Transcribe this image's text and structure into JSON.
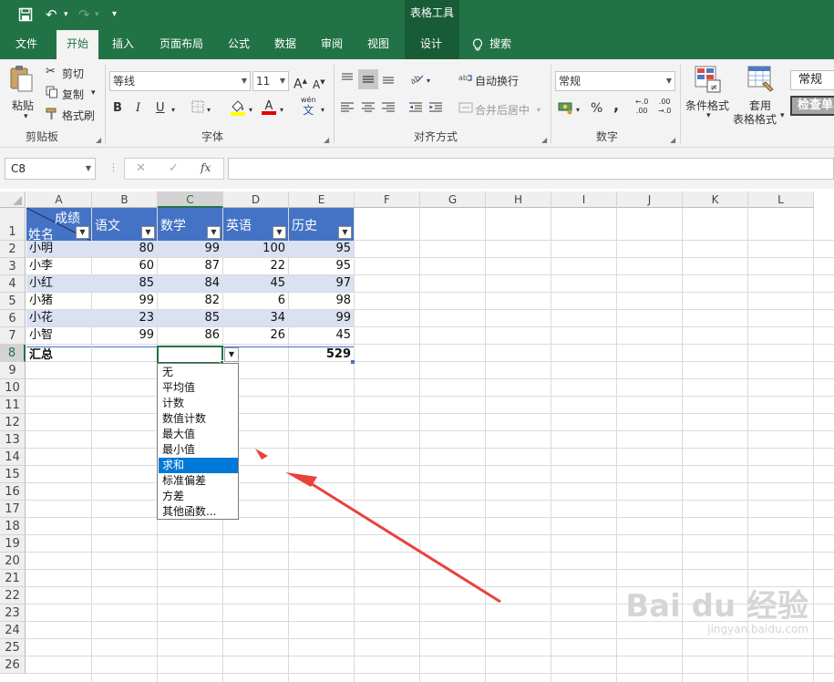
{
  "titlebar": {
    "undo": "↶",
    "redo": "↷",
    "customize": "▾",
    "context_title": "表格工具"
  },
  "tabs": [
    {
      "label": "文件"
    },
    {
      "label": "开始"
    },
    {
      "label": "插入"
    },
    {
      "label": "页面布局"
    },
    {
      "label": "公式"
    },
    {
      "label": "数据"
    },
    {
      "label": "审阅"
    },
    {
      "label": "视图"
    },
    {
      "label": "设计"
    },
    {
      "label": "搜索"
    }
  ],
  "ribbon": {
    "clipboard": {
      "paste": "粘贴",
      "cut": "剪切",
      "copy": "复制",
      "format_painter": "格式刷",
      "group": "剪贴板"
    },
    "font": {
      "name": "等线",
      "size": "11",
      "grow": "A",
      "shrink": "A",
      "bold": "B",
      "italic": "I",
      "underline": "U",
      "phonetic_top": "wén",
      "phonetic_bottom": "文",
      "group": "字体",
      "fill_color": "#ffff00",
      "font_color": "#e00000"
    },
    "alignment": {
      "wrap": "自动换行",
      "merge": "合并后居中",
      "group": "对齐方式"
    },
    "number": {
      "format": "常规",
      "percent": "%",
      "comma": ",",
      "inc_decimal_top": "←.0",
      "inc_decimal_bottom": ".00",
      "dec_decimal_top": ".00",
      "dec_decimal_bottom": "→.0",
      "group": "数字"
    },
    "styles": {
      "conditional": "条件格式",
      "table_format_1": "套用",
      "table_format_2": "表格格式",
      "normal": "常规",
      "check_cell": "检查单"
    }
  },
  "formula_bar": {
    "name_box": "C8",
    "cancel": "✕",
    "enter": "✓",
    "fx": "fx",
    "value": ""
  },
  "columns": [
    "A",
    "B",
    "C",
    "D",
    "E",
    "F",
    "G",
    "H",
    "I",
    "J",
    "K",
    "L"
  ],
  "rows": [
    "1",
    "2",
    "3",
    "4",
    "5",
    "6",
    "7",
    "8",
    "9",
    "10",
    "11",
    "12",
    "13",
    "14",
    "15",
    "16",
    "17",
    "18",
    "19",
    "20",
    "21",
    "22",
    "23",
    "24",
    "25",
    "26"
  ],
  "table": {
    "corner_top": "成绩",
    "corner_bottom": "姓名",
    "headers": [
      "语文",
      "数学",
      "英语",
      "历史"
    ],
    "rows": [
      {
        "name": "小明",
        "values": [
          "80",
          "99",
          "100",
          "95"
        ]
      },
      {
        "name": "小李",
        "values": [
          "60",
          "87",
          "22",
          "95"
        ]
      },
      {
        "name": "小红",
        "values": [
          "85",
          "84",
          "45",
          "97"
        ]
      },
      {
        "name": "小猪",
        "values": [
          "99",
          "82",
          "6",
          "98"
        ]
      },
      {
        "name": "小花",
        "values": [
          "23",
          "85",
          "34",
          "99"
        ]
      },
      {
        "name": "小智",
        "values": [
          "99",
          "86",
          "26",
          "45"
        ]
      }
    ],
    "total_label": "汇总",
    "total_history": "529",
    "header_color": "#4472c4",
    "band_color": "#d9e1f2"
  },
  "dropdown": {
    "items": [
      "无",
      "平均值",
      "计数",
      "数值计数",
      "最大值",
      "最小值",
      "求和",
      "标准偏差",
      "方差",
      "其他函数..."
    ],
    "selected": "求和"
  },
  "watermark": {
    "brand": "Bai du 经验",
    "site": "jingyan.baidu.com"
  },
  "annotation_color": "#e8423b"
}
